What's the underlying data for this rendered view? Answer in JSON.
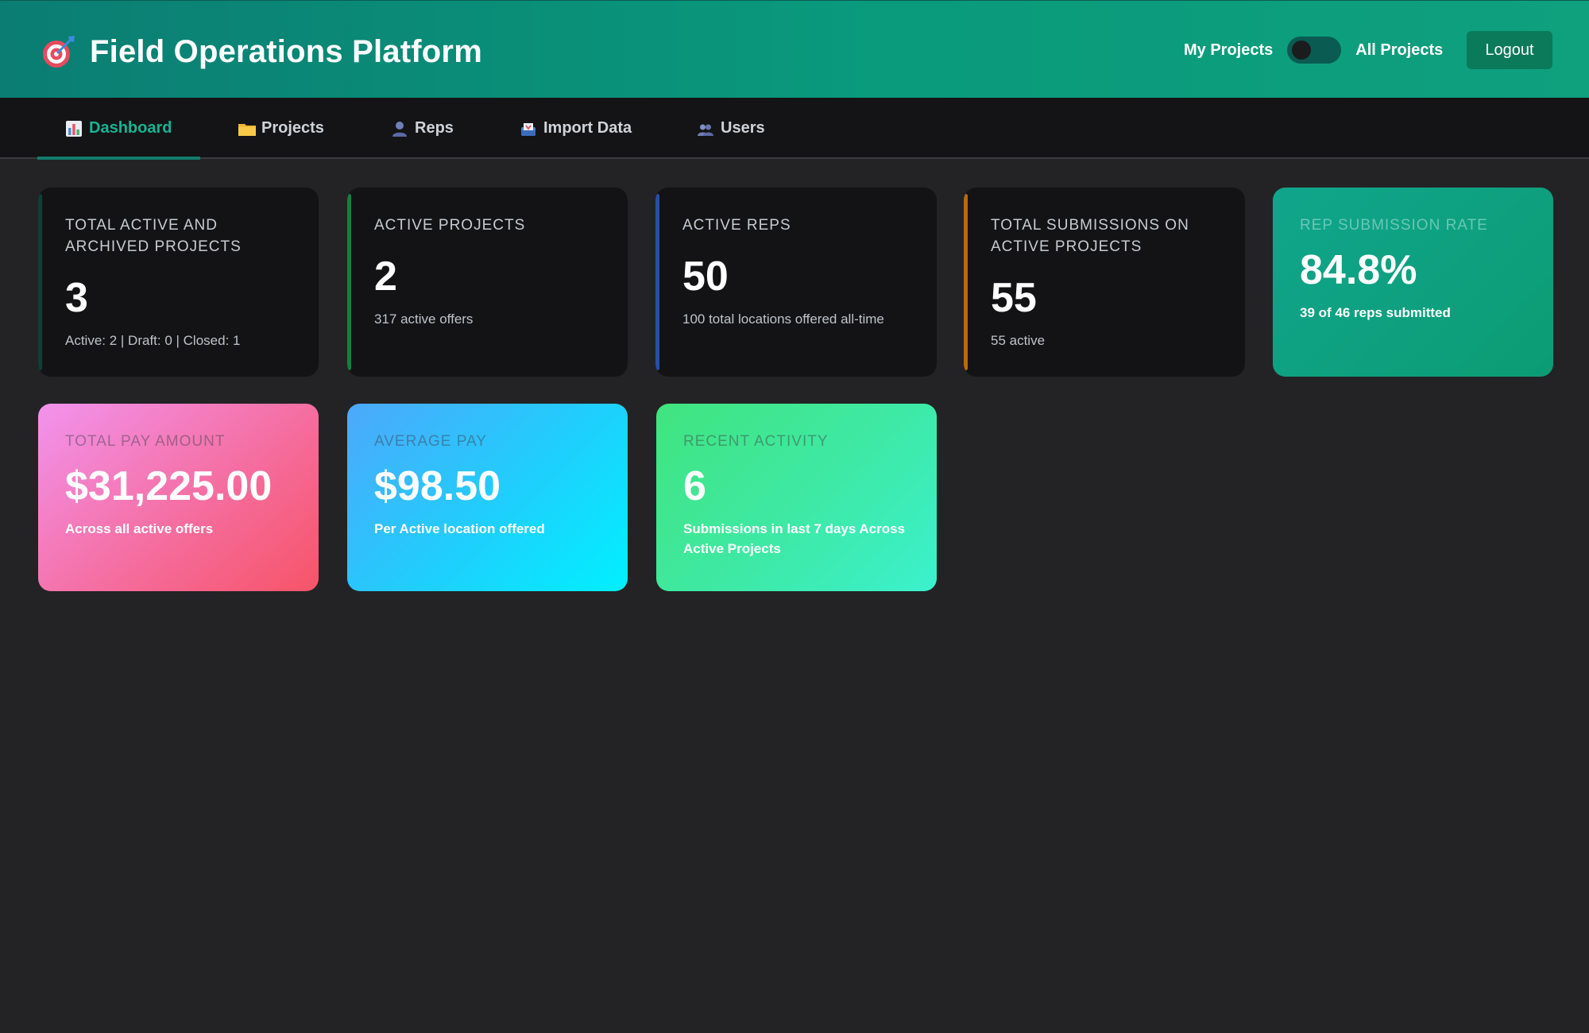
{
  "header": {
    "title": "Field Operations Platform",
    "logo_icon": "target-dart-icon",
    "toggle_left_label": "My Projects",
    "toggle_right_label": "All Projects",
    "logout_label": "Logout"
  },
  "nav": {
    "tabs": [
      {
        "label": "Dashboard",
        "icon": "bar-chart-icon",
        "active": true
      },
      {
        "label": "Projects",
        "icon": "folder-icon",
        "active": false
      },
      {
        "label": "Reps",
        "icon": "person-icon",
        "active": false
      },
      {
        "label": "Import Data",
        "icon": "inbox-tray-icon",
        "active": false
      },
      {
        "label": "Users",
        "icon": "people-icon",
        "active": false
      }
    ]
  },
  "cards": {
    "total_projects": {
      "title": "TOTAL ACTIVE AND ARCHIVED PROJECTS",
      "value": "3",
      "sub": "Active: 2 | Draft: 0 | Closed: 1"
    },
    "active_projects": {
      "title": "ACTIVE PROJECTS",
      "value": "2",
      "sub": "317 active offers"
    },
    "active_reps": {
      "title": "ACTIVE REPS",
      "value": "50",
      "sub": "100 total locations offered all-time"
    },
    "total_submissions": {
      "title": "TOTAL SUBMISSIONS ON ACTIVE PROJECTS",
      "value": "55",
      "sub": "55 active"
    },
    "submission_rate": {
      "title": "REP SUBMISSION RATE",
      "value": "84.8%",
      "sub": "39 of 46 reps submitted"
    },
    "total_pay": {
      "title": "TOTAL PAY AMOUNT",
      "value": "$31,225.00",
      "sub": "Across all active offers"
    },
    "average_pay": {
      "title": "AVERAGE PAY",
      "value": "$98.50",
      "sub": "Per Active location offered"
    },
    "recent_activity": {
      "title": "RECENT ACTIVITY",
      "value": "6",
      "sub": "Submissions in last 7 days Across Active Projects"
    }
  },
  "colors": {
    "header_bg": "#0a9a7c",
    "accent_teal": "#19b394",
    "accent_green": "#16a34a",
    "accent_blue": "#2563eb",
    "accent_orange": "#d97706",
    "background": "#232325",
    "card_bg": "#131315"
  }
}
